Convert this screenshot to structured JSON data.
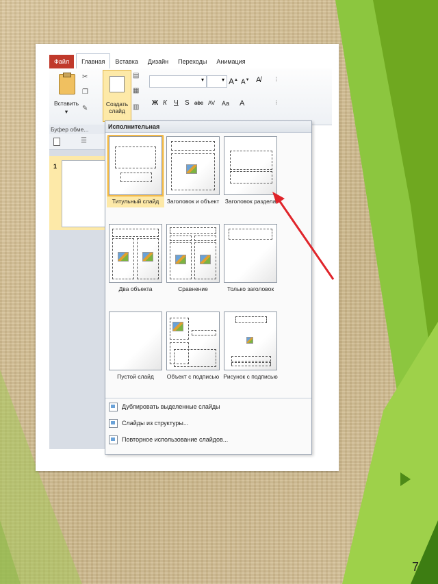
{
  "ribbon": {
    "tabs": [
      "Файл",
      "Главная",
      "Вставка",
      "Дизайн",
      "Переходы",
      "Анимация"
    ],
    "paste_label": "Вставить",
    "new_slide_label": "Создать слайд",
    "clipboard_group": "Буфер обме...",
    "format_buttons": [
      "Ж",
      "К",
      "Ч",
      "S",
      "abc",
      "AV",
      "Aa"
    ]
  },
  "slides_pane": {
    "slide_number": "1"
  },
  "layout_gallery": {
    "header": "Исполнительная",
    "layouts": [
      {
        "label": "Титульный слайд",
        "selected": true
      },
      {
        "label": "Заголовок и объект",
        "selected": false
      },
      {
        "label": "Заголовок раздела",
        "selected": false
      },
      {
        "label": "Два объекта",
        "selected": false
      },
      {
        "label": "Сравнение",
        "selected": false
      },
      {
        "label": "Только заголовок",
        "selected": false
      },
      {
        "label": "Пустой слайд",
        "selected": false
      },
      {
        "label": "Объект с подписью",
        "selected": false
      },
      {
        "label": "Рисунок с подписью",
        "selected": false
      }
    ],
    "commands": [
      "Дублировать выделенные слайды",
      "Слайды из структуры...",
      "Повторное использование слайдов..."
    ]
  },
  "page_number": "7",
  "colors": {
    "accent_green": "#6fa820",
    "arrow_red": "#e0242a",
    "selection": "#fde9a8"
  }
}
